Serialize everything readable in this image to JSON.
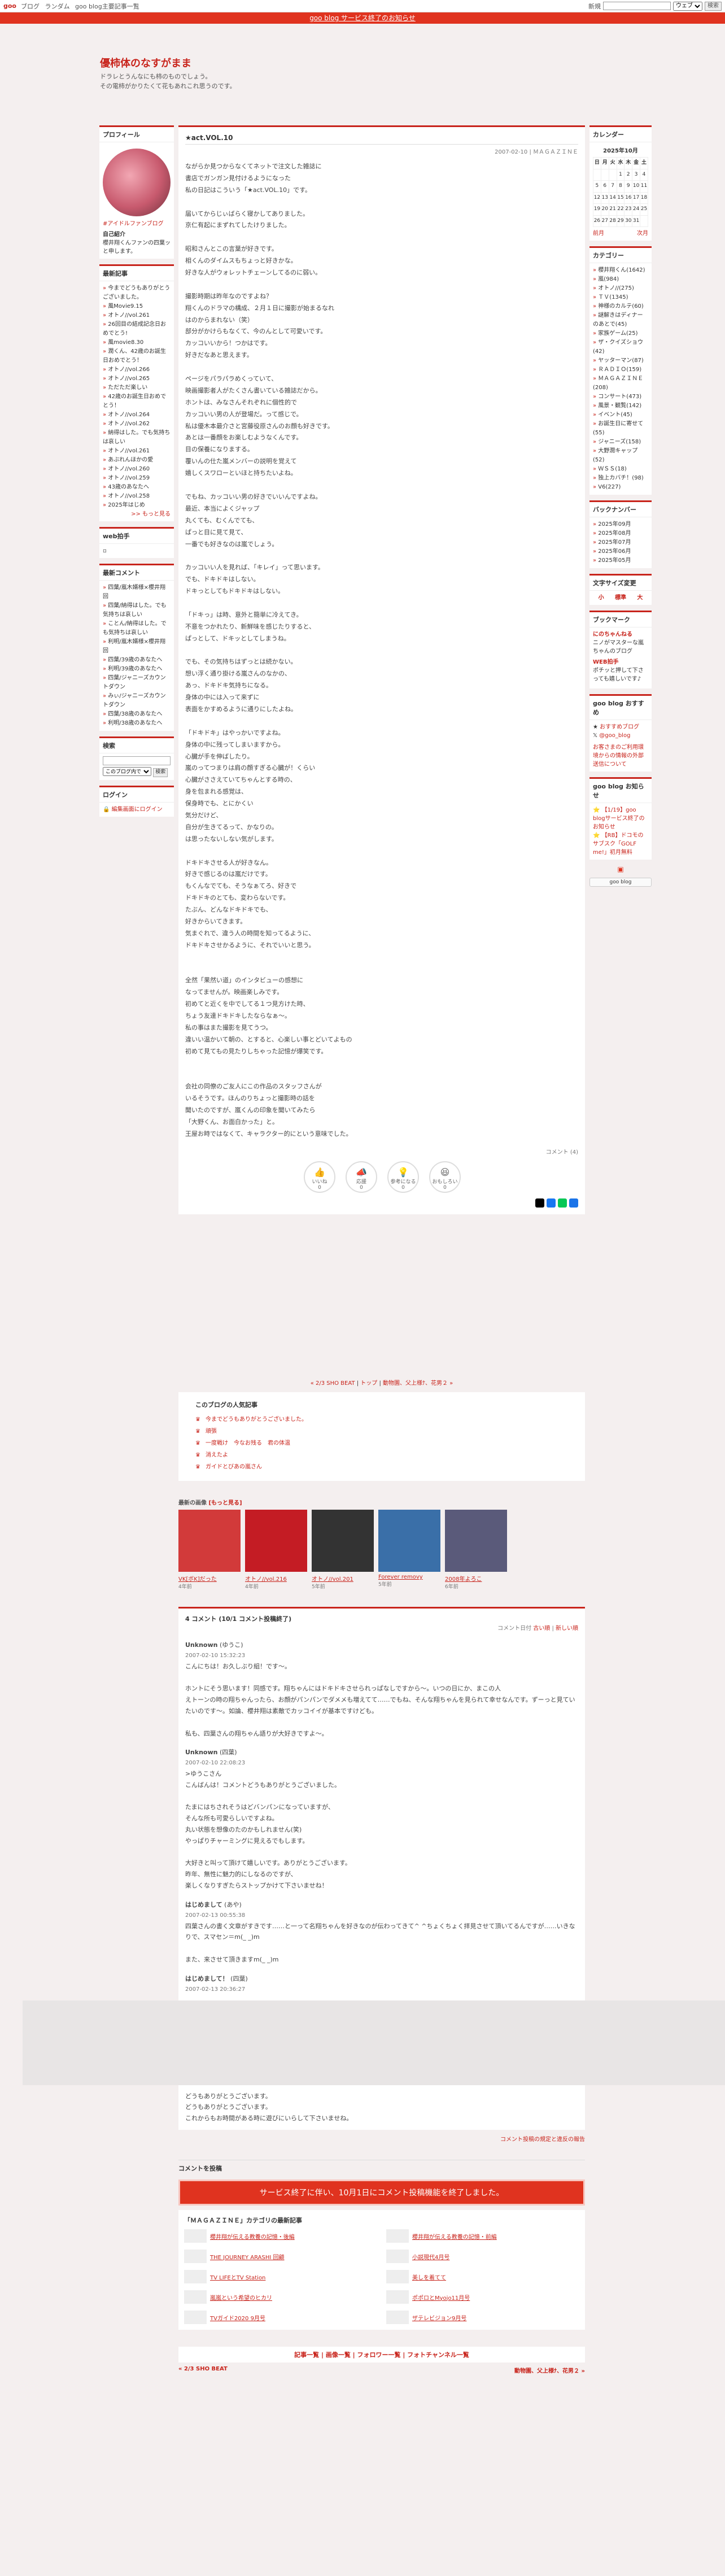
{
  "topbar": {
    "logo": "goo",
    "links": [
      "ブログ",
      "ランダム",
      "goo blog主要記事一覧"
    ],
    "new_label": "新規",
    "search_type": "ウェブ",
    "search_btn": "検索"
  },
  "notice_bar": {
    "text": "goo blog サービス終了のお知らせ"
  },
  "header": {
    "title": "優柿体のなすがまま",
    "desc_1": "ドラレとうんなにも柿のものでしょう。",
    "desc_2": "その電柿がかりたくて花もあれこれ思うのです。"
  },
  "profile": {
    "heading": "プロフィール",
    "link": "#アイドルファンブログ",
    "label": "自己紹介",
    "text": "櫻井翔くんファンの四葉ッと申します。"
  },
  "recent_posts": {
    "heading": "最新記事",
    "items": [
      "今までどうもありがとうございました。",
      "風Movie9.15",
      "オトノ//vol.261",
      "26回目の結成記念日おめでとう!",
      "風movie8.30",
      "潤くん、42歳のお誕生日おめでとう！",
      "オトノ//vol.266",
      "オトノ//vol.265",
      "ただただ楽しい",
      "42歳のお誕生日おめでとう！",
      "オトノ//vol.264",
      "オトノ//vol.262",
      "納得はした。でも気持ちは哀しい",
      "オトノ//vol.261",
      "あぶれんほかの愛",
      "オトノ//vol.260",
      "オトノ//vol.259",
      "43歳のあなたへ",
      "オトノ//vol.258",
      "2025年はじめ"
    ],
    "more": ">> もっと見る"
  },
  "web_clap": {
    "heading": "web拍手"
  },
  "recent_comments": {
    "heading": "最新コメント",
    "items": [
      "四葉/嵐木婿様×櫻井翔回",
      "四葉/納得はした。でも気持ちは哀しい",
      "ことん/納得はした。でも気持ちは哀しい",
      "利明/嵐木婿様×櫻井翔回",
      "四葉/39歳のあなたへ",
      "利明/39歳のあなたへ",
      "四葉/ジャニーズカウントダウン",
      "みぃ/ジャニーズカウントダウン",
      "四葉/38歳のあなたへ",
      "利明/38歳のあなたへ"
    ]
  },
  "search": {
    "heading": "検索",
    "scope": "このブログ内で",
    "button": "検索"
  },
  "login": {
    "heading": "ログイン",
    "link": "編集画面にログイン"
  },
  "article": {
    "title": "★act.VOL.10",
    "meta": "2007-02-10 | ＭＡＧＡＺＩＮＥ",
    "text": "ながらか見つからなくてネットで注文した雑誌に\n書店でガンガン見付けるようになった\n私の日記はこういう「★act.VOL.10」です。\n\n届いてからじぃばらく寝かしてありました。\n京仁有起にまずれてしたけりました。\n\n昭和さんとこの言葉が好きです。\n相くんのダイムスもちょっと好きかな。\n好きな人がウォレットチェーンしてるのに弱い。\n\n撮影時期は昨年なのですよね？\n翔くんのドラマの構成、２月１日に撮影が始まるなれ\nはのからまれない（笑）\n部分がかけらもなくて、今のんとして可愛いです。\nカッコいいから！つかはです。\n好きだなあと思えます。\n\nページをパラパラめくっていて、\n映画撮影者人がたくさん書いている雑誌だから。\nホントは、みなさんそれぞれに個性的で\nカッコいい男の人が登場だ。って感じで。\n私は優木本最介さと宮藤役原さんのお顔も好きです。\nあとは一番顔をお楽しむようなくんです。\n目の保養になりまする。\n覆いんの仕た嵐メンバーの説明を覚えて\n嬉しくスワローといほと持ちたいよね。\n\nでもね、カッコいい男の好きでいいんですよね。\n最近、本当によくジャップ\n丸くても、むくんでても、\nぱっと目に見て見て、\n一番でも好きなのは嵐でしょう。\n\nカッコいい人を見れば、「キレイ」って思います。\nでも、ドキドキはしない。\nドキっとしてもドキドキはしない。\n\n「ドキっ」は時、意外と簡単に冷えてき。\n不意をつかれたり、新鮮味を感じたりすると、\nぱっとして、ドキッとしてしまうね。\n\nでも、その気持ちはずっとは続かない。\n想い浮く通り掛ける嵐さんのなかの、\nあっ、ドキドキ気持ちになる。\n身体の中には入って来ずに\n表面をかすめるように通りにしたよね。\n\n「ドキドキ」はやっかいですよね。\n身体の中に残ってしまいますから。\n心臓が手を伸ばしたり。\n嵐のってつまりは肩の顔すぎる心臓が！くらい\n心臓がささえていてちゃんとする時の、\n身を包まれる感覚は、\n保身時でも、とにかくい\n気分だけど、\n自分が生きてるって、かなりの。\nは思ったないしない気がします。\n\nドキドキさせる人が好きなん。\n好きで感じるのは嵐だけです。\nもくんなでても、そうなぁてろ、好きで\nドキドキのとても、変わらないです。\nたぶん、どんなドキドキでも、\n好きからいてきます。\n気まぐれで、違う人の時間を知ってるように、\nドキドキさせかるように、それでいいと思う。\n\n\n全然「果然い道」のインタビューの感想に\nなってませんが。映画楽しみです。\n初めてと近くを中でしてる１つ見方けた時、\nちょう友達ドキドキしたならなぁ～。\n私の事はまた撮影を見てうつ。\n違いい温かいて朝の、とすると、心楽しい事とどいてよもの\n初めて見てもの見たりしちゃった記憶が爆笑です。\n\n\n会社の同僚のご友人にこの作品のスタッフさんが\nいるそうです。ほんのりちょっと撮影時の話を\n聞いたのですが、嵐くんの印象を聞いてみたら\n「大野くん、お面白かった」と。\n王屋お時ではなくて、キャラクター的にという意味でした。",
    "comment_count": "コメント (4)"
  },
  "reactions": [
    {
      "label": "いいね",
      "count": "0"
    },
    {
      "label": "応援",
      "count": "0"
    },
    {
      "label": "参考になる",
      "count": "0"
    },
    {
      "label": "おもしろい",
      "count": "0"
    }
  ],
  "nav": {
    "prev": "« 2/3 SHO BEAT",
    "top": "トップ",
    "next": "動物園、父上様ﾅ、花男２ »"
  },
  "popular": {
    "heading": "このブログの人気記事",
    "items": [
      "今までどうもありがとうございました。",
      "頑張",
      "一度戦け　今なお残る　君の体温",
      "消えたよ",
      "ガイドとびあの嵐さん"
    ]
  },
  "recent_articles": {
    "heading": "最新の画像",
    "more": "[もっと見る]",
    "items": [
      {
        "cap": "VK[ボK]だった",
        "ago": "4年前"
      },
      {
        "cap": "オトノ//vol.216",
        "ago": "4年前"
      },
      {
        "cap": "オトノ//vol.201",
        "ago": "5年前"
      },
      {
        "cap": "Forever removy",
        "ago": "5年前"
      },
      {
        "cap": "2008年よろこ",
        "ago": "6年前"
      }
    ]
  },
  "comments": {
    "heading": "4 コメント (10/1 コメント投稿終了)",
    "sort_label": "コメント日付",
    "sort_old": "古い順",
    "sort_new": "新しい順",
    "items": [
      {
        "who": "Unknown",
        "name": "(ゆうこ)",
        "date": "2007-02-10 15:32:23",
        "text": "こんにちは！お久しぶり組！です〜。\n\nホントにそう思います！同感です。翔ちゃんにはドキドキさせられっぱなしですから～。いつの日にか、まこの人\nえトーンの時の翔ちゃんったら、お顔がパンパンでダメメも増えてて……でもね、そんな翔ちゃんを見られて幸せなんです。ずーっと見ていたいのです〜。如論、櫻井翔は素敵でカッコイイが基本ですけども。\n\n私も、四葉さんの翔ちゃん語りが大好きですよ～。"
      },
      {
        "who": "Unknown",
        "name": "(四葉)",
        "date": "2007-02-10 22:08:23",
        "text": ">ゆうこさん\nこんばんは！コメントどうもありがとうございました。\n\nたまにはちされそうはどバンパンになっていますが、\nそんな所も可愛らしいですよね。\n丸い状態を想像のたのかもしれません(笑)\nやっぱりチャーミングに見えるでもします。\n\n大好きと叫って頂けて嬉しいです。ありがとうございます。\n昨年、無性に魅力的にしなるのですが、\n楽しくなりすぎたらストップかけて下さいませね！"
      },
      {
        "who": "はじめまして",
        "name": "(あや)",
        "date": "2007-02-13 00:55:38",
        "text": "四葉さんの書く文章がすきです……と一って名翔ちゃんを好きなのが伝わってきて^ ^ちょくちょく拝見させて頂いてるんですが……いきなりで、スマセン＝m(_ _)m\n\nまた、来させて頂きますm(_ _)m"
      },
      {
        "who": "はじめまして！",
        "name": "(四葉)",
        "date": "2007-02-13 20:36:27",
        "text": ""
      }
    ],
    "after": "どうもありがとうございます。\nどうもありがとうございます。\nこれからもお時間がある時に遊びにいらして下さいませね。",
    "rules": "コメント投稿の規定と違反の報告",
    "form_heading": "コメントを投稿",
    "closed_notice": "サービス終了に伴い、10月1日にコメント投稿機能を終了しました。"
  },
  "category_box": {
    "heading": "「ＭＡＧＡＺＩＮＥ」カテゴリの最新記事",
    "items": [
      "櫻井翔が伝える教養の記憶・後編",
      "櫻井翔が伝える教養の記憶・前編",
      "THE JOURNEY ARASHI 回顧",
      "小説現代4月号",
      "TV LIFEとTV Station",
      "美しを着てて",
      "嵐嵐という希望のヒカリ",
      "ポポロとMyojo11月号",
      "TVガイド2020 9月号",
      "ザテレビジョン9月号"
    ]
  },
  "footer": {
    "links": "記事一覧 | 画像一覧 | フォロワー一覧 | フォトチャンネル一覧",
    "prev": "« 2/3 SHO BEAT",
    "next": "動物園、父上様ﾅ、花男２ »"
  },
  "calendar": {
    "heading": "カレンダー",
    "caption": "2025年10月",
    "weekdays": [
      "日",
      "月",
      "火",
      "水",
      "木",
      "金",
      "土"
    ],
    "rows": [
      [
        "",
        "",
        "",
        "1",
        "2",
        "3",
        "4"
      ],
      [
        "5",
        "6",
        "7",
        "8",
        "9",
        "10",
        "11"
      ],
      [
        "12",
        "13",
        "14",
        "15",
        "16",
        "17",
        "18"
      ],
      [
        "19",
        "20",
        "21",
        "22",
        "23",
        "24",
        "25"
      ],
      [
        "26",
        "27",
        "28",
        "29",
        "30",
        "31",
        ""
      ]
    ],
    "prev": "前月",
    "next": "次月"
  },
  "categories": {
    "heading": "カテゴリー",
    "items": [
      "櫻井翔くん(1642)",
      "嵐(984)",
      "オトノ//(275)",
      "ＴＶ(1345)",
      "神様のカルテ(60)",
      "謎解きはディナーのあとで(45)",
      "家族ゲーム(25)",
      "ザ・クイズショウ(42)",
      "ヤッターマン(87)",
      "ＲＡＤＩＯ(159)",
      "ＭＡＧＡＺＩＮＥ(208)",
      "コンサート(473)",
      "風景・観覧(142)",
      "イベント(45)",
      "お誕生日に寄せて(55)",
      "ジャニーズ(158)",
      "大野潤キャップ(52)",
      "ＷＳＳ(18)",
      "独上カバチ！(98)",
      "V6(227)"
    ]
  },
  "archives": {
    "heading": "バックナンバー",
    "items": [
      "2025年09月",
      "2025年08月",
      "2025年07月",
      "2025年06月",
      "2025年05月"
    ]
  },
  "font_size": {
    "heading": "文字サイズ変更",
    "small": "小",
    "normal": "標準",
    "large": "大"
  },
  "bookmark": {
    "heading": "ブックマーク",
    "items": [
      {
        "name": "にのちゃんねる",
        "desc": "ニノがマスターな嵐ちゃんのブログ"
      },
      {
        "name": "WEB拍手",
        "desc": "ポチッと押して下さっても嬉しいです♪"
      }
    ]
  },
  "goo_recommend": {
    "heading": "goo blog おすすめ",
    "items": [
      "おすすめブログ",
      "@goo_blog"
    ],
    "notice": "お客さまのご利用環境からの情報の外部送信について"
  },
  "goo_news": {
    "heading": "goo blog お知らせ",
    "items": [
      "【1/19】goo blogサービス終了のお知らせ",
      "【RB】ドコモのサブスク「GOLF me!」初月無料"
    ]
  },
  "rss_btn": "goo blog"
}
